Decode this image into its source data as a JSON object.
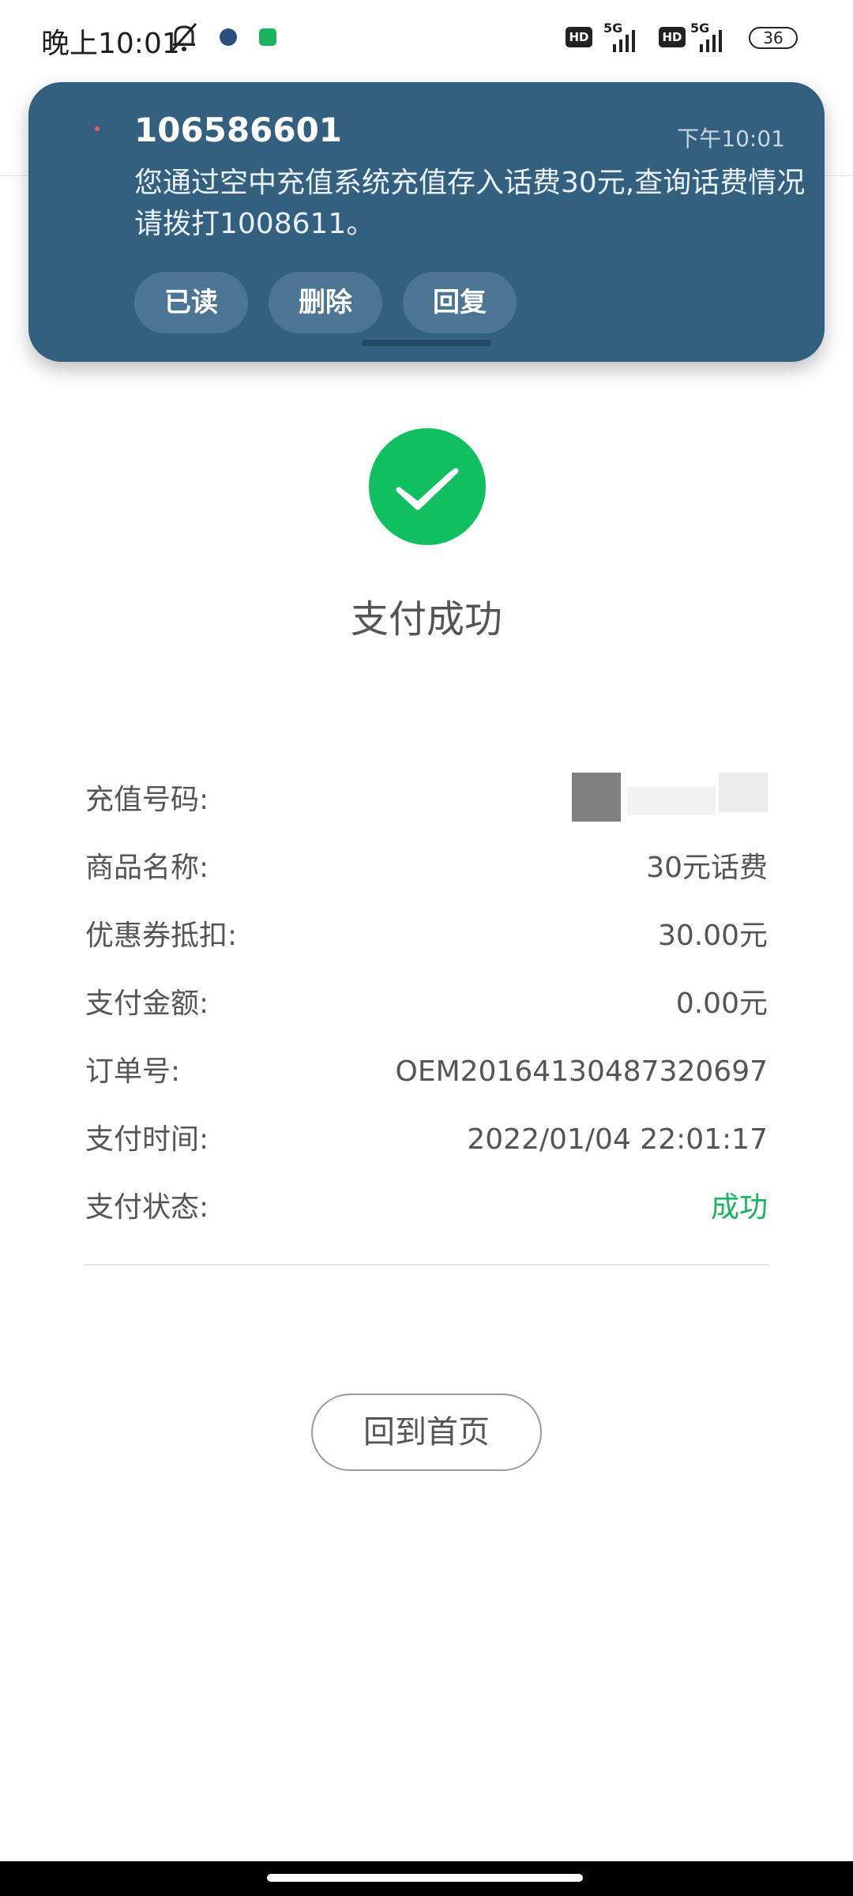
{
  "status_bar": {
    "time": "晚上10:01",
    "hd_label": "HD",
    "network_label": "5G",
    "battery_level": "36",
    "icons": [
      "mute-bell-icon",
      "app-notification-icon",
      "wechat-icon",
      "hd-icon",
      "signal-icon",
      "battery-icon"
    ]
  },
  "notification": {
    "sender": "106586601",
    "time": "下午10:01",
    "body": "您通过空中充值系统充值存入话费30元,查询话费情况请拨打1008611。",
    "buttons": {
      "read": "已读",
      "delete": "删除",
      "reply": "回复"
    }
  },
  "success": {
    "title": "支付成功",
    "icon": "check-icon",
    "color": "#10c060"
  },
  "details": {
    "rows": [
      {
        "label": "充值号码:",
        "value": ""
      },
      {
        "label": "商品名称:",
        "value": "30元话费"
      },
      {
        "label": "优惠券抵扣:",
        "value": "30.00元"
      },
      {
        "label": "支付金额:",
        "value": "0.00元"
      },
      {
        "label": "订单号:",
        "value": "OEM20164130487320697"
      },
      {
        "label": "支付时间:",
        "value": "2022/01/04 22:01:17"
      },
      {
        "label": "支付状态:",
        "value": "成功"
      }
    ]
  },
  "actions": {
    "home_button": "回到首页"
  },
  "colors": {
    "notification_bg": "#33607f",
    "success_green": "#1ab35f"
  }
}
